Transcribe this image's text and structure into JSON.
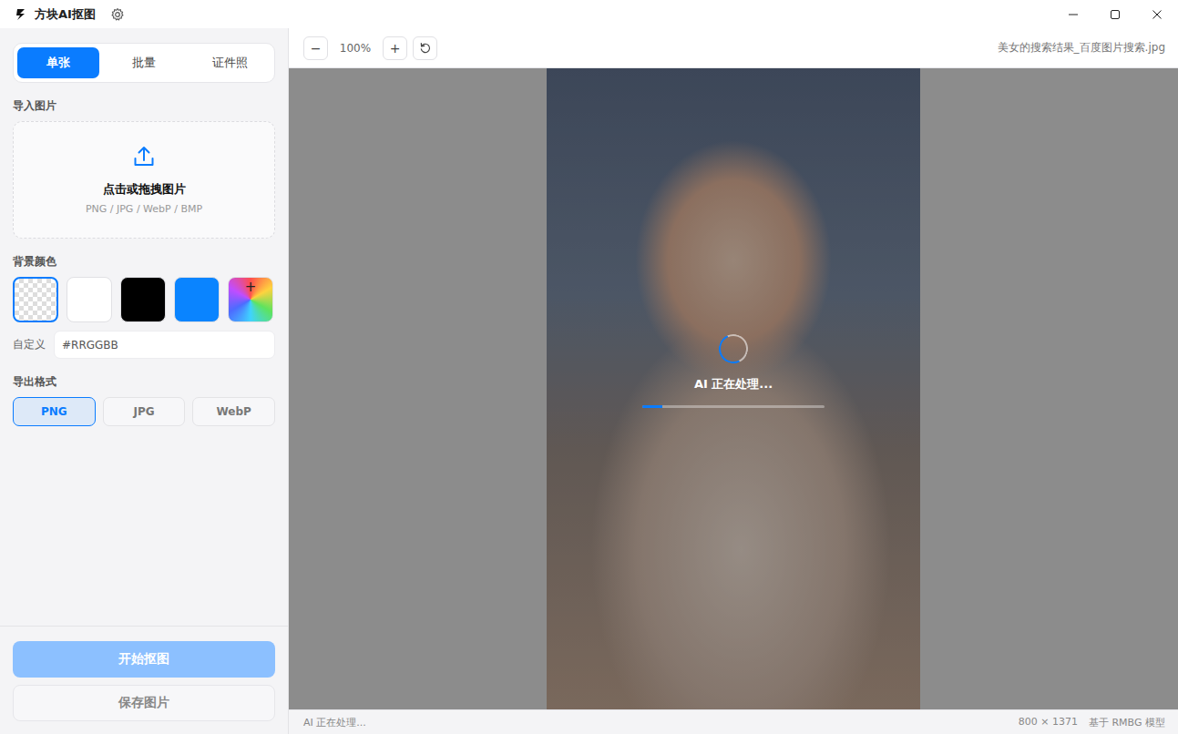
{
  "window": {
    "title": "方块AI抠图"
  },
  "tabs": [
    {
      "label": "单张",
      "selected": true
    },
    {
      "label": "批量",
      "selected": false
    },
    {
      "label": "证件照",
      "selected": false
    }
  ],
  "import": {
    "label": "导入图片",
    "prompt": "点击或拖拽图片",
    "formats": "PNG / JPG / WebP / BMP"
  },
  "background": {
    "label": "背景颜色",
    "swatches": [
      {
        "kind": "transparent",
        "selected": true
      },
      {
        "kind": "solid",
        "color": "#ffffff",
        "selected": false
      },
      {
        "kind": "solid",
        "color": "#000000",
        "selected": false
      },
      {
        "kind": "solid",
        "color": "#0a84ff",
        "selected": false
      },
      {
        "kind": "picker",
        "label": "+",
        "selected": false
      }
    ],
    "custom": {
      "label": "自定义",
      "placeholder": "#RRGGBB"
    }
  },
  "export": {
    "label": "导出格式",
    "formats": [
      {
        "label": "PNG",
        "selected": true
      },
      {
        "label": "JPG",
        "selected": false
      },
      {
        "label": "WebP",
        "selected": false
      }
    ]
  },
  "actions": [
    {
      "label": "开始抠图",
      "kind": "primary",
      "disabled": true
    },
    {
      "label": "保存图片",
      "kind": "secondary",
      "disabled": true
    }
  ],
  "toolbar": {
    "zoom_out": "−",
    "zoom": "100%",
    "zoom_in": "+",
    "filename": "美女的搜索结果_百度图片搜索.jpg"
  },
  "processing": {
    "text": "AI 正在处理...",
    "level": 0.11
  },
  "status_bar": {
    "text": "AI 正在处理...",
    "dimensions": "800 × 1371",
    "model": "基于 RMBG 模型"
  }
}
